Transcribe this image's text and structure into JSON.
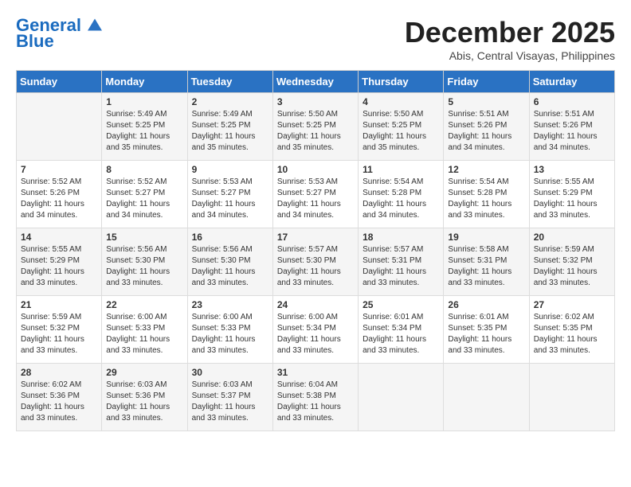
{
  "logo": {
    "line1": "General",
    "line2": "Blue"
  },
  "title": "December 2025",
  "location": "Abis, Central Visayas, Philippines",
  "days_header": [
    "Sunday",
    "Monday",
    "Tuesday",
    "Wednesday",
    "Thursday",
    "Friday",
    "Saturday"
  ],
  "weeks": [
    [
      {
        "day": "",
        "sunrise": "",
        "sunset": "",
        "daylight": ""
      },
      {
        "day": "1",
        "sunrise": "Sunrise: 5:49 AM",
        "sunset": "Sunset: 5:25 PM",
        "daylight": "Daylight: 11 hours and 35 minutes."
      },
      {
        "day": "2",
        "sunrise": "Sunrise: 5:49 AM",
        "sunset": "Sunset: 5:25 PM",
        "daylight": "Daylight: 11 hours and 35 minutes."
      },
      {
        "day": "3",
        "sunrise": "Sunrise: 5:50 AM",
        "sunset": "Sunset: 5:25 PM",
        "daylight": "Daylight: 11 hours and 35 minutes."
      },
      {
        "day": "4",
        "sunrise": "Sunrise: 5:50 AM",
        "sunset": "Sunset: 5:25 PM",
        "daylight": "Daylight: 11 hours and 35 minutes."
      },
      {
        "day": "5",
        "sunrise": "Sunrise: 5:51 AM",
        "sunset": "Sunset: 5:26 PM",
        "daylight": "Daylight: 11 hours and 34 minutes."
      },
      {
        "day": "6",
        "sunrise": "Sunrise: 5:51 AM",
        "sunset": "Sunset: 5:26 PM",
        "daylight": "Daylight: 11 hours and 34 minutes."
      }
    ],
    [
      {
        "day": "7",
        "sunrise": "Sunrise: 5:52 AM",
        "sunset": "Sunset: 5:26 PM",
        "daylight": "Daylight: 11 hours and 34 minutes."
      },
      {
        "day": "8",
        "sunrise": "Sunrise: 5:52 AM",
        "sunset": "Sunset: 5:27 PM",
        "daylight": "Daylight: 11 hours and 34 minutes."
      },
      {
        "day": "9",
        "sunrise": "Sunrise: 5:53 AM",
        "sunset": "Sunset: 5:27 PM",
        "daylight": "Daylight: 11 hours and 34 minutes."
      },
      {
        "day": "10",
        "sunrise": "Sunrise: 5:53 AM",
        "sunset": "Sunset: 5:27 PM",
        "daylight": "Daylight: 11 hours and 34 minutes."
      },
      {
        "day": "11",
        "sunrise": "Sunrise: 5:54 AM",
        "sunset": "Sunset: 5:28 PM",
        "daylight": "Daylight: 11 hours and 34 minutes."
      },
      {
        "day": "12",
        "sunrise": "Sunrise: 5:54 AM",
        "sunset": "Sunset: 5:28 PM",
        "daylight": "Daylight: 11 hours and 33 minutes."
      },
      {
        "day": "13",
        "sunrise": "Sunrise: 5:55 AM",
        "sunset": "Sunset: 5:29 PM",
        "daylight": "Daylight: 11 hours and 33 minutes."
      }
    ],
    [
      {
        "day": "14",
        "sunrise": "Sunrise: 5:55 AM",
        "sunset": "Sunset: 5:29 PM",
        "daylight": "Daylight: 11 hours and 33 minutes."
      },
      {
        "day": "15",
        "sunrise": "Sunrise: 5:56 AM",
        "sunset": "Sunset: 5:30 PM",
        "daylight": "Daylight: 11 hours and 33 minutes."
      },
      {
        "day": "16",
        "sunrise": "Sunrise: 5:56 AM",
        "sunset": "Sunset: 5:30 PM",
        "daylight": "Daylight: 11 hours and 33 minutes."
      },
      {
        "day": "17",
        "sunrise": "Sunrise: 5:57 AM",
        "sunset": "Sunset: 5:30 PM",
        "daylight": "Daylight: 11 hours and 33 minutes."
      },
      {
        "day": "18",
        "sunrise": "Sunrise: 5:57 AM",
        "sunset": "Sunset: 5:31 PM",
        "daylight": "Daylight: 11 hours and 33 minutes."
      },
      {
        "day": "19",
        "sunrise": "Sunrise: 5:58 AM",
        "sunset": "Sunset: 5:31 PM",
        "daylight": "Daylight: 11 hours and 33 minutes."
      },
      {
        "day": "20",
        "sunrise": "Sunrise: 5:59 AM",
        "sunset": "Sunset: 5:32 PM",
        "daylight": "Daylight: 11 hours and 33 minutes."
      }
    ],
    [
      {
        "day": "21",
        "sunrise": "Sunrise: 5:59 AM",
        "sunset": "Sunset: 5:32 PM",
        "daylight": "Daylight: 11 hours and 33 minutes."
      },
      {
        "day": "22",
        "sunrise": "Sunrise: 6:00 AM",
        "sunset": "Sunset: 5:33 PM",
        "daylight": "Daylight: 11 hours and 33 minutes."
      },
      {
        "day": "23",
        "sunrise": "Sunrise: 6:00 AM",
        "sunset": "Sunset: 5:33 PM",
        "daylight": "Daylight: 11 hours and 33 minutes."
      },
      {
        "day": "24",
        "sunrise": "Sunrise: 6:00 AM",
        "sunset": "Sunset: 5:34 PM",
        "daylight": "Daylight: 11 hours and 33 minutes."
      },
      {
        "day": "25",
        "sunrise": "Sunrise: 6:01 AM",
        "sunset": "Sunset: 5:34 PM",
        "daylight": "Daylight: 11 hours and 33 minutes."
      },
      {
        "day": "26",
        "sunrise": "Sunrise: 6:01 AM",
        "sunset": "Sunset: 5:35 PM",
        "daylight": "Daylight: 11 hours and 33 minutes."
      },
      {
        "day": "27",
        "sunrise": "Sunrise: 6:02 AM",
        "sunset": "Sunset: 5:35 PM",
        "daylight": "Daylight: 11 hours and 33 minutes."
      }
    ],
    [
      {
        "day": "28",
        "sunrise": "Sunrise: 6:02 AM",
        "sunset": "Sunset: 5:36 PM",
        "daylight": "Daylight: 11 hours and 33 minutes."
      },
      {
        "day": "29",
        "sunrise": "Sunrise: 6:03 AM",
        "sunset": "Sunset: 5:36 PM",
        "daylight": "Daylight: 11 hours and 33 minutes."
      },
      {
        "day": "30",
        "sunrise": "Sunrise: 6:03 AM",
        "sunset": "Sunset: 5:37 PM",
        "daylight": "Daylight: 11 hours and 33 minutes."
      },
      {
        "day": "31",
        "sunrise": "Sunrise: 6:04 AM",
        "sunset": "Sunset: 5:38 PM",
        "daylight": "Daylight: 11 hours and 33 minutes."
      },
      {
        "day": "",
        "sunrise": "",
        "sunset": "",
        "daylight": ""
      },
      {
        "day": "",
        "sunrise": "",
        "sunset": "",
        "daylight": ""
      },
      {
        "day": "",
        "sunrise": "",
        "sunset": "",
        "daylight": ""
      }
    ]
  ]
}
